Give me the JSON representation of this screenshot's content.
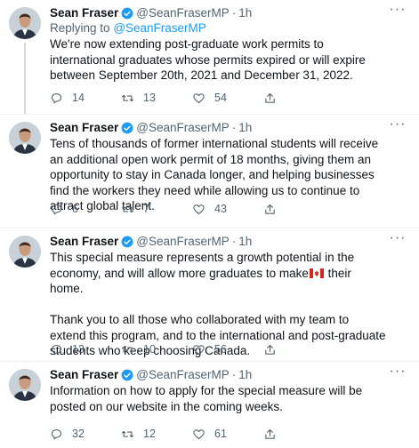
{
  "tweets": [
    {
      "author": {
        "name": "Sean Fraser",
        "handle": "@SeanFraserMP",
        "verified": true
      },
      "separator": "·",
      "time": "1h",
      "replying_prefix": "Replying to",
      "replying_to": "@SeanFraserMP",
      "text": "We're now extending post-graduate work permits to international graduates whose permits expired or will expire between September 20th, 2021 and December 31, 2022.",
      "reply_count": "14",
      "retweet_count": "13",
      "like_count": "54"
    },
    {
      "author": {
        "name": "Sean Fraser",
        "handle": "@SeanFraserMP",
        "verified": true
      },
      "separator": "·",
      "time": "1h",
      "text": "Tens of thousands of former international students will receive an additional open work permit of 18 months, giving them an opportunity to stay in Canada longer, and helping businesses find the workers they need while allowing us to continue to attract global talent.",
      "reply_count": "6",
      "retweet_count": "7",
      "like_count": "43"
    },
    {
      "author": {
        "name": "Sean Fraser",
        "handle": "@SeanFraserMP",
        "verified": true
      },
      "separator": "·",
      "time": "1h",
      "text_part1": "This special measure represents a growth potential in the   economy, and will allow more graduates to make",
      "text_part2": " their home.",
      "text_part3": "\n\nThank you to all those who collaborated with my team to extend this program, and to the international and post-graduate students who keep choosing Canada.",
      "reply_count": "13",
      "retweet_count": "10",
      "like_count": "56"
    },
    {
      "author": {
        "name": "Sean Fraser",
        "handle": "@SeanFraserMP",
        "verified": true
      },
      "separator": "·",
      "time": "1h",
      "text": "Information on how to apply for the special measure will be posted on our website in the coming weeks.",
      "reply_count": "32",
      "retweet_count": "12",
      "like_count": "61"
    }
  ],
  "icons": {
    "verified": "verified-badge-icon",
    "more": "more-options-icon",
    "reply": "reply-icon",
    "retweet": "retweet-icon",
    "like": "heart-icon",
    "share": "share-icon",
    "flag": "canada-flag-icon"
  },
  "colors": {
    "verified": "#1d9bf0",
    "mention": "#1d9bf0",
    "secondary_text": "#536471",
    "divider": "#eff3f4",
    "flag_red": "#d52b1e"
  }
}
